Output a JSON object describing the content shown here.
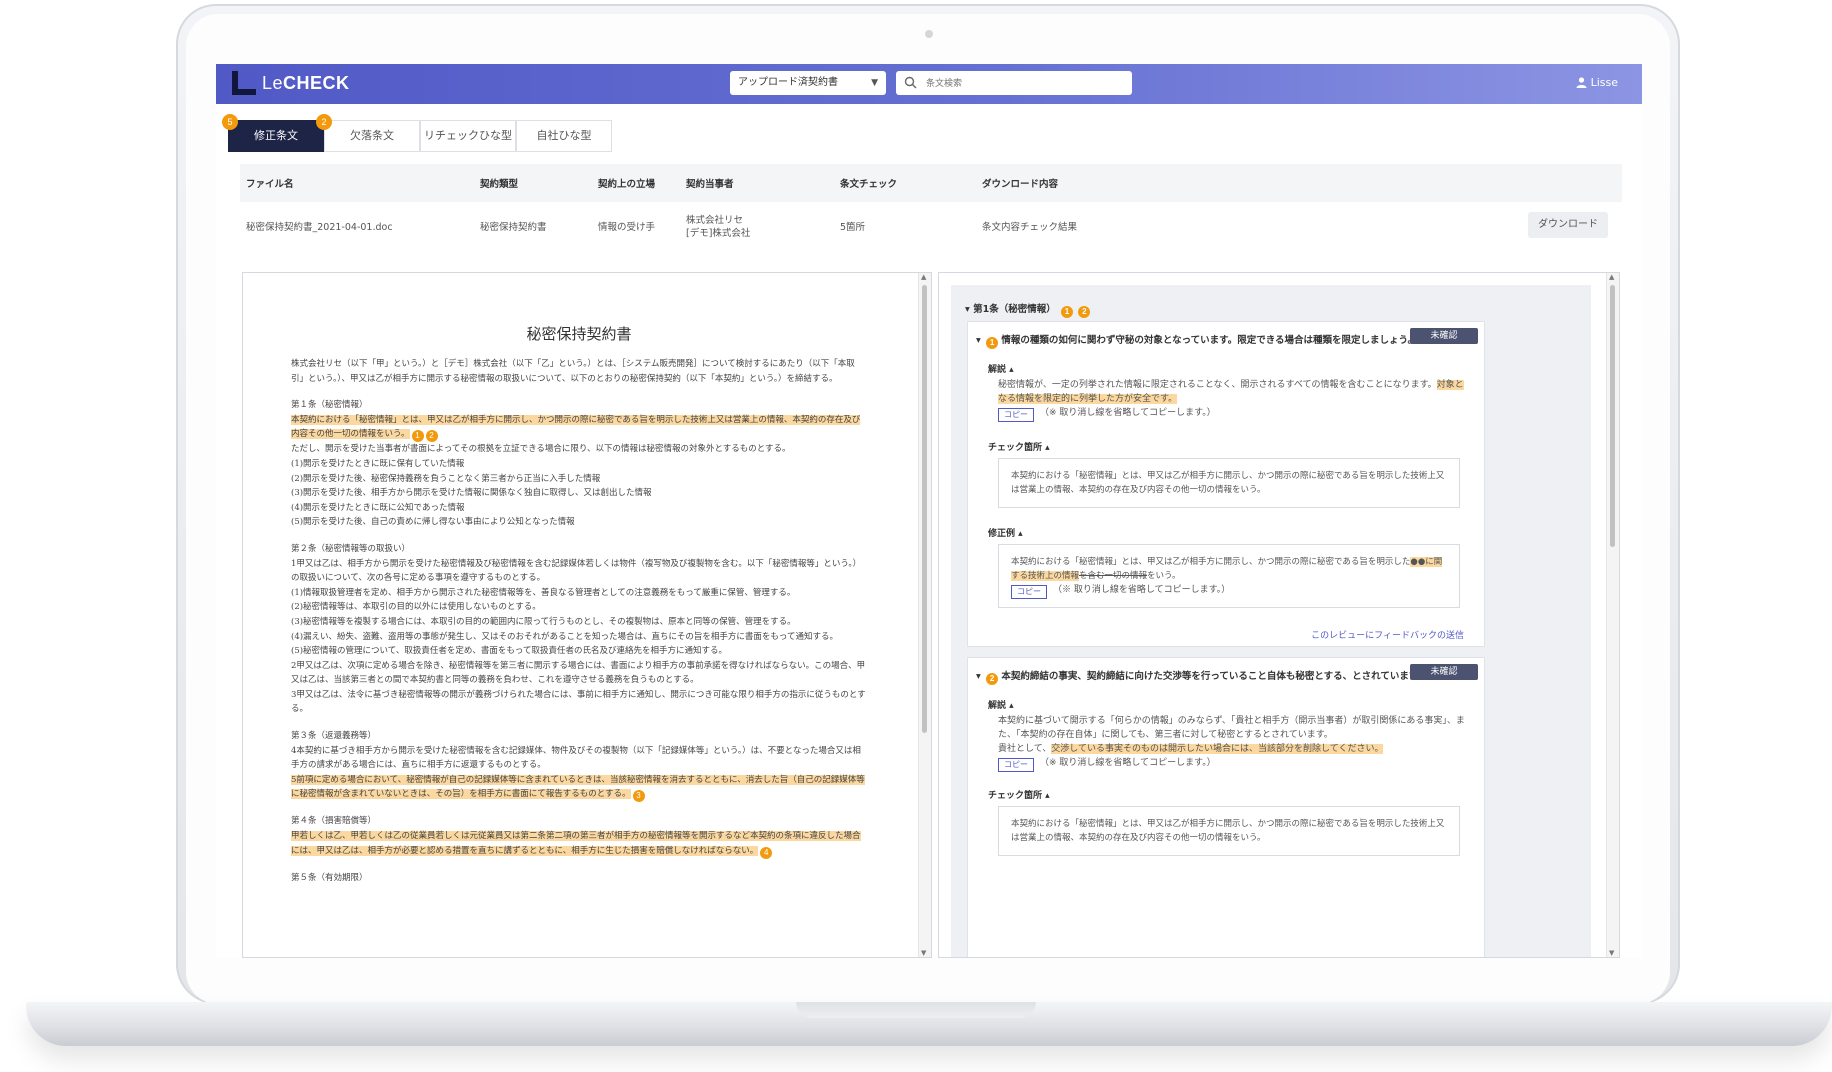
{
  "app": {
    "logo_le": "Le",
    "logo_check": "CHECK",
    "user": "Lisse"
  },
  "header": {
    "select_value": "アップロード済契約書",
    "search_placeholder": "条文検索"
  },
  "tabs": [
    {
      "label": "修正条文",
      "badge": "5"
    },
    {
      "label": "欠落条文",
      "badge": "2"
    },
    {
      "label": "リチェックひな型"
    },
    {
      "label": "自社ひな型"
    }
  ],
  "info": {
    "headers": [
      "ファイル名",
      "契約類型",
      "契約上の立場",
      "契約当事者",
      "条文チェック",
      "ダウンロード内容"
    ],
    "file_name": "秘密保持契約書_2021-04-01.doc",
    "contract_type": "秘密保持契約書",
    "position": "情報の受け手",
    "party_1": "株式会社リセ",
    "party_2": "[デモ]株式会社",
    "check_count": "5箇所",
    "download_content": "条文内容チェック結果",
    "download_button": "ダウンロード"
  },
  "document": {
    "title": "秘密保持契約書",
    "intro": "株式会社リセ（以下「甲」という。）と［デモ］株式会社（以下「乙」という。）とは、［システム販売開発］について検討するにあたり（以下「本取引」という。）、甲又は乙が相手方に開示する秘密情報の取扱いについて、以下のとおりの秘密保持契約（以下「本契約」という。）を締結する。",
    "art1_title": "第１条（秘密情報）",
    "art1_hl": "本契約における「秘密情報」とは、甲又は乙が相手方に開示し、かつ開示の際に秘密である旨を明示した技術上又は営業上の情報、本契約の存在及び内容その他一切の情報をいう。",
    "art1_b1": "1",
    "art1_b2": "2",
    "art1_body": "ただし、開示を受けた当事者が書面によってその根拠を立証できる場合に限り、以下の情報は秘密情報の対象外とするものとする。",
    "art1_items": [
      "(1)開示を受けたときに既に保有していた情報",
      "(2)開示を受けた後、秘密保持義務を負うことなく第三者から正当に入手した情報",
      "(3)開示を受けた後、相手方から開示を受けた情報に関係なく独自に取得し、又は創出した情報",
      "(4)開示を受けたときに既に公知であった情報",
      "(5)開示を受けた後、自己の責めに帰し得ない事由により公知となった情報"
    ],
    "art2_title": "第２条（秘密情報等の取扱い）",
    "art2_lines": [
      "1甲又は乙は、相手方から開示を受けた秘密情報及び秘密情報を含む記録媒体若しくは物件（複写物及び複製物を含む。以下「秘密情報等」という。）の取扱いについて、次の各号に定める事項を遵守するものとする。",
      "(1)情報取扱管理者を定め、相手方から開示された秘密情報等を、善良なる管理者としての注意義務をもって厳重に保管、管理する。",
      "(2)秘密情報等は、本取引の目的以外には使用しないものとする。",
      "(3)秘密情報等を複製する場合には、本取引の目的の範囲内に限って行うものとし、その複製物は、原本と同等の保管、管理をする。",
      "(4)漏えい、紛失、盗難、盗用等の事態が発生し、又はそのおそれがあることを知った場合は、直ちにその旨を相手方に書面をもって通知する。",
      "(5)秘密情報の管理について、取扱責任者を定め、書面をもって取扱責任者の氏名及び連絡先を相手方に通知する。",
      "2甲又は乙は、次項に定める場合を除き、秘密情報等を第三者に開示する場合には、書面により相手方の事前承諾を得なければならない。この場合、甲又は乙は、当該第三者との間で本契約書と同等の義務を負わせ、これを遵守させる義務を負うものとする。",
      "3甲又は乙は、法令に基づき秘密情報等の開示が義務づけられた場合には、事前に相手方に通知し、開示につき可能な限り相手方の指示に従うものとする。"
    ],
    "art3_title": "第３条（返還義務等）",
    "art3_body": "4本契約に基づき相手方から開示を受けた秘密情報を含む記録媒体、物件及びその複製物（以下「記録媒体等」という。）は、不要となった場合又は相手方の請求がある場合には、直ちに相手方に返還するものとする。",
    "art3_hl": "5前項に定める場合において、秘密情報が自己の記録媒体等に含まれているときは、当該秘密情報を消去するとともに、消去した旨（自己の記録媒体等に秘密情報が含まれていないときは、その旨）を相手方に書面にて報告するものとする。",
    "art3_badge": "3",
    "art4_title": "第４条（損害賠償等）",
    "art4_hl": "甲若しくは乙、甲若しくは乙の従業員若しくは元従業員又は第二条第二項の第三者が相手方の秘密情報等を開示するなど本契約の条項に違反した場合には、甲又は乙は、相手方が必要と認める措置を直ちに講ずるとともに、相手方に生じた損害を賠償しなければならない。",
    "art4_badge": "4",
    "art5_title": "第５条（有効期限）"
  },
  "review": {
    "section_title": "第1条（秘密情報）",
    "section_badges": [
      "1",
      "2"
    ],
    "status_label": "未確認",
    "copy_label": "コピー",
    "copy_note": "（※ 取り消し線を省略してコピーします。）",
    "cards": [
      {
        "badge": "1",
        "question": "情報の種類の如何に関わず守秘の対象となっています。限定できる場合は種類を限定しましょう。",
        "explanation_label": "解説",
        "explanation": "秘密情報が、一定の列挙された情報に限定されることなく、開示されるすべての情報を含むことになります。",
        "explanation_hl": "対象となる情報を限定的に列挙した方が安全です。",
        "check_label": "チェック箇所",
        "check_text": "本契約における「秘密情報」とは、甲又は乙が相手方に開示し、かつ開示の際に秘密である旨を明示した技術上又は営業上の情報、本契約の存在及び内容その他一切の情報をいう。",
        "fix_label": "修正例",
        "fix_text": "本契約における「秘密情報」とは、甲又は乙が相手方に開示し、かつ開示の際に秘密である旨を明示した",
        "fix_hl": "●●に関する技術上の情報",
        "fix_strike": "を含む一切の情報",
        "fix_end": "をいう。",
        "feedback": "このレビューにフィードバックの送信"
      },
      {
        "badge": "2",
        "question": "本契約締結の事実、契約締結に向けた交渉等を行っていること自体も秘密とする、とされています。",
        "explanation_label": "解説",
        "explanation": "本契約に基づいて開示する「何らかの情報」のみならず、「貴社と相手方（開示当事者）が取引関係にある事実」、また、「本契約の存在自体」に関しても、第三者に対して秘密とするとされています。",
        "explanation_2": "貴社として、",
        "explanation_hl": "交渉している事実そのものは開示したい場合には、当該部分を削除してください。",
        "check_label": "チェック箇所",
        "check_text": "本契約における「秘密情報」とは、甲又は乙が相手方に開示し、かつ開示の際に秘密である旨を明示した技術上又は営業上の情報、本契約の存在及び内容その他一切の情報をいう。"
      }
    ]
  },
  "colors": {
    "accent": "#5159c6",
    "navy": "#1d2446",
    "badge": "#f29a0c",
    "highlight": "#fbd89f"
  }
}
